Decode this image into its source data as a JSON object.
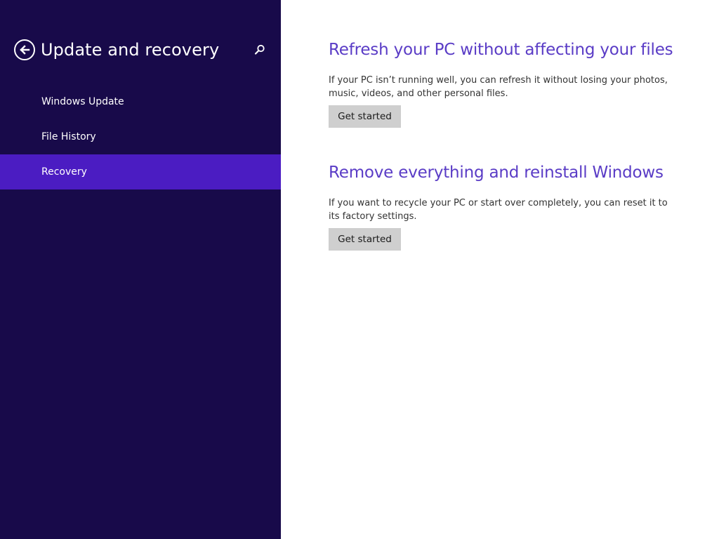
{
  "colors": {
    "sidebar_bg": "#180a4a",
    "selected_item_bg": "#4b1cc2",
    "heading_accent": "#5a3cc6",
    "button_bg": "#cfcfcf"
  },
  "sidebar": {
    "back_icon": "back-arrow-circle-icon",
    "title": "Update and recovery",
    "search_icon": "search-icon",
    "items": [
      {
        "label": "Windows Update",
        "selected": false
      },
      {
        "label": "File History",
        "selected": false
      },
      {
        "label": "Recovery",
        "selected": true
      }
    ]
  },
  "main": {
    "sections": [
      {
        "title": "Refresh your PC without affecting your files",
        "description": "If your PC isn’t running well, you can refresh it without losing your photos, music, videos, and other personal files.",
        "button_label": "Get started"
      },
      {
        "title": "Remove everything and reinstall Windows",
        "description": "If you want to recycle your PC or start over completely, you can reset it to its factory settings.",
        "button_label": "Get started"
      }
    ]
  }
}
